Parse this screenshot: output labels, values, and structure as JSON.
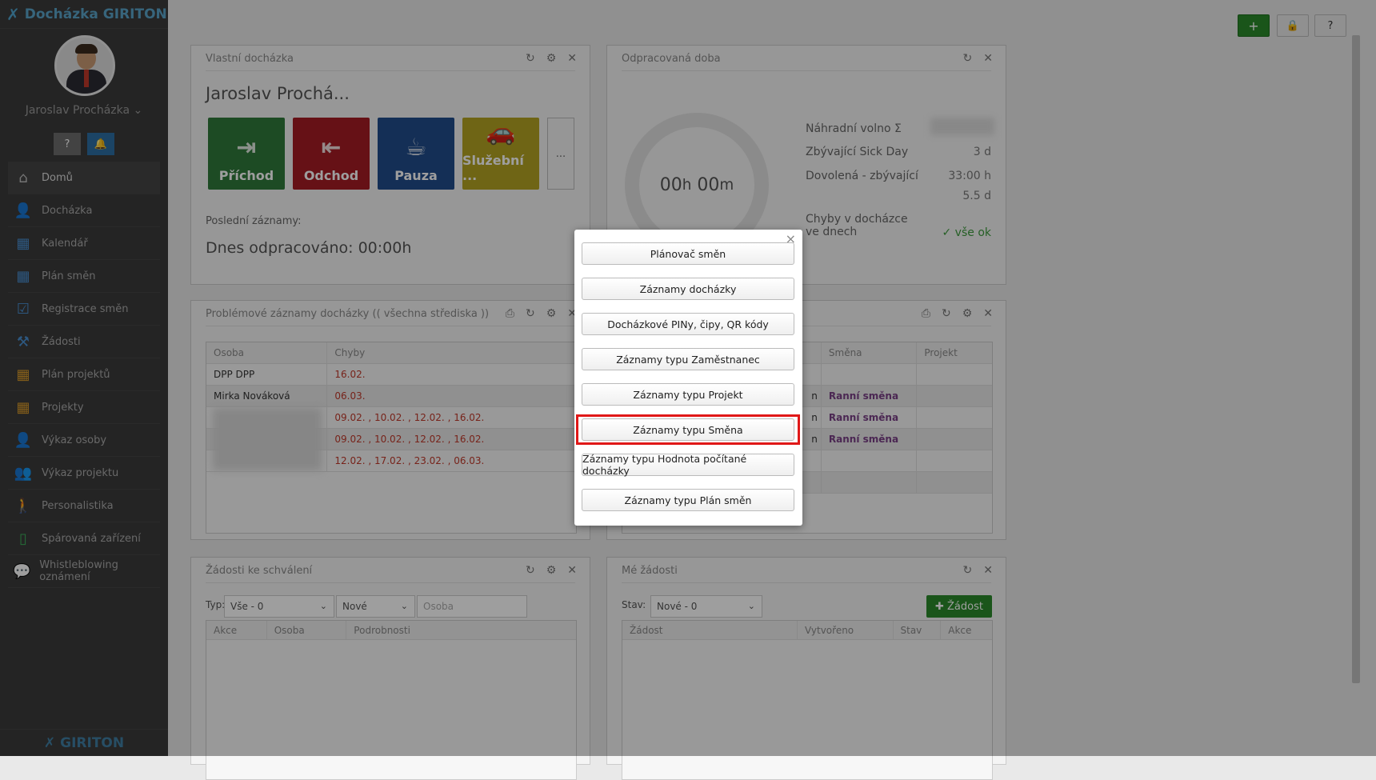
{
  "app": {
    "brand": "Docházka GIRITON",
    "footer_brand": "GIRITON"
  },
  "user": {
    "name": "Jaroslav Procházka"
  },
  "sidebar": {
    "items": [
      {
        "label": "Domů",
        "icon": "home-icon",
        "glyph": "⌂"
      },
      {
        "label": "Docházka",
        "icon": "user-icon",
        "glyph": "👤"
      },
      {
        "label": "Kalendář",
        "icon": "calendar-icon",
        "glyph": "▦"
      },
      {
        "label": "Plán směn",
        "icon": "calendar-grid-icon",
        "glyph": "▦"
      },
      {
        "label": "Registrace směn",
        "icon": "calendar-check-icon",
        "glyph": "☑"
      },
      {
        "label": "Žádosti",
        "icon": "gavel-icon",
        "glyph": "⚒"
      },
      {
        "label": "Plán projektů",
        "icon": "calendar-icon",
        "glyph": "▦"
      },
      {
        "label": "Projekty",
        "icon": "calendar-icon",
        "glyph": "▦"
      },
      {
        "label": "Výkaz osoby",
        "icon": "user-icon",
        "glyph": "👤"
      },
      {
        "label": "Výkaz projektu",
        "icon": "users-icon",
        "glyph": "👥"
      },
      {
        "label": "Personalistika",
        "icon": "person-icon",
        "glyph": "🚶"
      },
      {
        "label": "Spárovaná zařízení",
        "icon": "mobile-icon",
        "glyph": "▯"
      },
      {
        "label": "Whistleblowing oznámení",
        "icon": "chat-icon",
        "glyph": "💬"
      }
    ]
  },
  "panels": {
    "own": {
      "title": "Vlastní docházka",
      "owner": "Jaroslav Prochá...",
      "buttons": [
        "Příchod",
        "Odchod",
        "Pauza",
        "Služební ..."
      ],
      "more": "...",
      "last_label": "Poslední záznamy:",
      "today": "Dnes odpracováno: 00:00h"
    },
    "worked": {
      "title": "Odpracovaná doba",
      "ring_h": "00",
      "ring_m": "00",
      "ring_h_unit": "h",
      "ring_m_unit": "m",
      "stats": [
        {
          "label": "Náhradní volno Σ",
          "value": ""
        },
        {
          "label": "Zbývající Sick Day",
          "value": "3 d"
        },
        {
          "label": "Dovolená - zbývající",
          "value": "33:00 h"
        },
        {
          "label": "",
          "value": "5.5 d"
        }
      ],
      "errors_label_1": "Chyby v docházce",
      "errors_label_2": "ve dnech",
      "errors_value": "✓ vše ok"
    },
    "problems": {
      "title": "Problémové záznamy docházky (( všechna střediska ))",
      "headers": [
        "Osoba",
        "Chyby"
      ],
      "rows": [
        {
          "person": "DPP DPP",
          "errors": "16.02."
        },
        {
          "person": "Mirka Nováková",
          "errors": "06.03."
        },
        {
          "person": "",
          "errors": "09.02. , 10.02. , 12.02. , 16.02."
        },
        {
          "person": "",
          "errors": "09.02. , 10.02. , 12.02. , 16.02."
        },
        {
          "person": "",
          "errors": "12.02. , 17.02. , 23.02. , 06.03."
        }
      ]
    },
    "shifts": {
      "headers": [
        "Směna",
        "Projekt"
      ],
      "rows": [
        "",
        "Ranní směna",
        "Ranní směna",
        "Ranní směna",
        "",
        ""
      ],
      "row_marks": [
        "",
        "n",
        "n",
        "n",
        "",
        ""
      ]
    },
    "approvals": {
      "title": "Žádosti ke schválení",
      "type_label": "Typ:",
      "type_value": "Vše - 0",
      "state_value": "Nové",
      "person_placeholder": "Osoba",
      "headers": [
        "Akce",
        "Osoba",
        "Podrobnosti"
      ]
    },
    "my_requests": {
      "title": "Mé žádosti",
      "state_label": "Stav:",
      "state_value": "Nové - 0",
      "add_label": "Žádost",
      "headers": [
        "Žádost",
        "Vytvořeno",
        "Stav",
        "Akce"
      ]
    }
  },
  "modal": {
    "close": "×",
    "buttons": [
      "Plánovač směn",
      "Záznamy docházky",
      "Docházkové PINy, čipy, QR kódy",
      "Záznamy typu Zaměstnanec",
      "Záznamy typu Projekt",
      "Záznamy typu Směna",
      "Záznamy typu Hodnota počítané docházky",
      "Záznamy typu Plán směn"
    ]
  },
  "colors": {
    "accent_green": "#2a8a2a",
    "highlight": "#e01818",
    "brand": "#4fa3cd"
  }
}
